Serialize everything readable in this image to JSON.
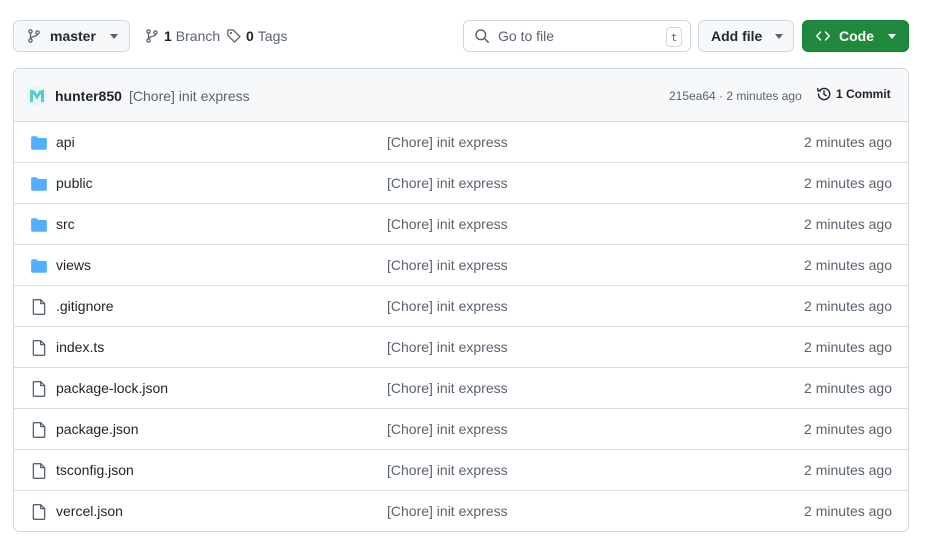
{
  "toolbar": {
    "branch_label": "master",
    "branches_count": "1",
    "branches_label": "Branch",
    "tags_count": "0",
    "tags_label": "Tags",
    "goto_placeholder": "Go to file",
    "goto_shortcut": "t",
    "add_file_label": "Add file",
    "code_label": "Code"
  },
  "commit": {
    "author": "hunter850",
    "message": "[Chore] init express",
    "meta": "215ea64 · 2 minutes ago",
    "commits_label": "1 Commit"
  },
  "files": [
    {
      "name": "api",
      "type": "folder",
      "message": "[Chore] init express",
      "time": "2 minutes ago"
    },
    {
      "name": "public",
      "type": "folder",
      "message": "[Chore] init express",
      "time": "2 minutes ago"
    },
    {
      "name": "src",
      "type": "folder",
      "message": "[Chore] init express",
      "time": "2 minutes ago"
    },
    {
      "name": "views",
      "type": "folder",
      "message": "[Chore] init express",
      "time": "2 minutes ago"
    },
    {
      "name": ".gitignore",
      "type": "file",
      "message": "[Chore] init express",
      "time": "2 minutes ago"
    },
    {
      "name": "index.ts",
      "type": "file",
      "message": "[Chore] init express",
      "time": "2 minutes ago"
    },
    {
      "name": "package-lock.json",
      "type": "file",
      "message": "[Chore] init express",
      "time": "2 minutes ago"
    },
    {
      "name": "package.json",
      "type": "file",
      "message": "[Chore] init express",
      "time": "2 minutes ago"
    },
    {
      "name": "tsconfig.json",
      "type": "file",
      "message": "[Chore] init express",
      "time": "2 minutes ago"
    },
    {
      "name": "vercel.json",
      "type": "file",
      "message": "[Chore] init express",
      "time": "2 minutes ago"
    }
  ],
  "colors": {
    "folder": "#54aeff",
    "code_button": "#1f883d",
    "muted": "#59636e"
  }
}
